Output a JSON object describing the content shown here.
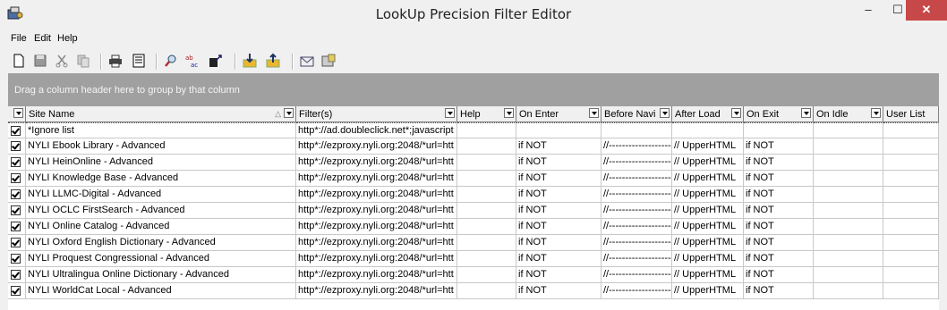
{
  "window": {
    "title": "LookUp Precision Filter Editor",
    "min": "–",
    "max": "☐",
    "close": "✕"
  },
  "menu": [
    "File",
    "Edit",
    "Help"
  ],
  "toolbar_icons": [
    "new-icon",
    "save-icon",
    "cut-icon",
    "copy-icon",
    "print-icon",
    "print-preview-icon",
    "find-icon",
    "spell-check-icon",
    "replace-icon",
    "import-icon",
    "export-icon",
    "email-icon",
    "settings-icon"
  ],
  "group_panel": {
    "text": "Drag a column header here to group by that column"
  },
  "grid": {
    "columns": [
      "",
      "Site Name",
      "Filter(s)",
      "Help",
      "On Enter",
      "Before Navi",
      "After Load",
      "On Exit",
      "On Idle",
      "User List"
    ],
    "rows": [
      {
        "checked": true,
        "site": "*Ignore list",
        "filter": "http*://ad.doubleclick.net*;javascript",
        "help": "",
        "on_enter": "",
        "before_navi": "",
        "after_load": "",
        "on_exit": "",
        "on_idle": "",
        "user_list": ""
      },
      {
        "checked": true,
        "site": "NYLI Ebook Library - Advanced",
        "filter": "http*://ezproxy.nyli.org:2048/*url=htt",
        "help": "",
        "on_enter": "if NOT",
        "before_navi": "//---------------------",
        "after_load": "// UpperHTML",
        "on_exit": "if NOT",
        "on_idle": "",
        "user_list": ""
      },
      {
        "checked": true,
        "site": "NYLI HeinOnline - Advanced",
        "filter": "http*://ezproxy.nyli.org:2048/*url=htt",
        "help": "",
        "on_enter": "if NOT",
        "before_navi": "//---------------------",
        "after_load": "// UpperHTML",
        "on_exit": "if NOT",
        "on_idle": "",
        "user_list": ""
      },
      {
        "checked": true,
        "site": "NYLI Knowledge Base - Advanced",
        "filter": "http*://ezproxy.nyli.org:2048/*url=htt",
        "help": "",
        "on_enter": "if NOT",
        "before_navi": "//---------------------",
        "after_load": "// UpperHTML",
        "on_exit": "if NOT",
        "on_idle": "",
        "user_list": ""
      },
      {
        "checked": true,
        "site": "NYLI LLMC-Digital - Advanced",
        "filter": "http*://ezproxy.nyli.org:2048/*url=htt",
        "help": "",
        "on_enter": "if NOT",
        "before_navi": "//---------------------",
        "after_load": "// UpperHTML",
        "on_exit": "if NOT",
        "on_idle": "",
        "user_list": ""
      },
      {
        "checked": true,
        "site": "NYLI OCLC FirstSearch - Advanced",
        "filter": "http*://ezproxy.nyli.org:2048/*url=htt",
        "help": "",
        "on_enter": "if NOT",
        "before_navi": "//---------------------",
        "after_load": "// UpperHTML",
        "on_exit": "if NOT",
        "on_idle": "",
        "user_list": ""
      },
      {
        "checked": true,
        "site": "NYLI Online Catalog - Advanced",
        "filter": "http*://ezproxy.nyli.org:2048/*url=htt",
        "help": "",
        "on_enter": "if NOT",
        "before_navi": "//---------------------",
        "after_load": "// UpperHTML",
        "on_exit": "if NOT",
        "on_idle": "",
        "user_list": ""
      },
      {
        "checked": true,
        "site": "NYLI Oxford English Dictionary - Advanced",
        "filter": "http*://ezproxy.nyli.org:2048/*url=htt",
        "help": "",
        "on_enter": "if NOT",
        "before_navi": "//---------------------",
        "after_load": "// UpperHTML",
        "on_exit": "if NOT",
        "on_idle": "",
        "user_list": ""
      },
      {
        "checked": true,
        "site": "NYLI Proquest Congressional - Advanced",
        "filter": "http*://ezproxy.nyli.org:2048/*url=htt",
        "help": "",
        "on_enter": "if NOT",
        "before_navi": "//---------------------",
        "after_load": "// UpperHTML",
        "on_exit": "if NOT",
        "on_idle": "",
        "user_list": ""
      },
      {
        "checked": true,
        "site": "NYLI Ultralingua Online Dictionary - Advanced",
        "filter": "http*://ezproxy.nyli.org:2048/*url=htt",
        "help": "",
        "on_enter": "if NOT",
        "before_navi": "//---------------------",
        "after_load": "// UpperHTML",
        "on_exit": "if NOT",
        "on_idle": "",
        "user_list": ""
      },
      {
        "checked": true,
        "site": "NYLI WorldCat Local - Advanced",
        "filter": "http*://ezproxy.nyli.org:2048/*url=htt",
        "help": "",
        "on_enter": "if NOT",
        "before_navi": "//---------------------",
        "after_load": "// UpperHTML",
        "on_exit": "if NOT",
        "on_idle": "",
        "user_list": ""
      }
    ]
  },
  "colors": {
    "close_button": "#c74848",
    "group_panel": "#a0a0a0",
    "grid_background": "#ffffff"
  }
}
